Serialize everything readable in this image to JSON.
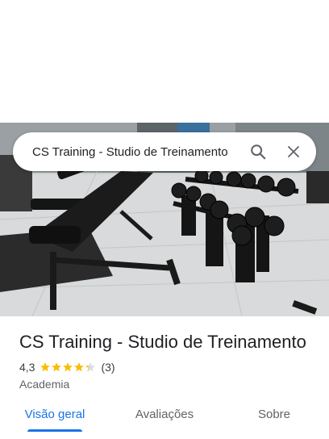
{
  "search": {
    "query": "CS Training - Studio de Treinamento"
  },
  "place": {
    "name": "CS Training - Studio de Treinamento",
    "rating": "4,3",
    "rating_stars": 4.3,
    "review_count": "(3)",
    "category": "Academia"
  },
  "tabs": [
    {
      "label": "Visão geral",
      "active": true
    },
    {
      "label": "Avaliações",
      "active": false
    },
    {
      "label": "Sobre",
      "active": false
    }
  ],
  "colors": {
    "accent": "#1a73e8",
    "star": "#fbbc04"
  },
  "icons": {
    "search": "search-icon",
    "close": "close-icon",
    "star": "star-icon"
  }
}
